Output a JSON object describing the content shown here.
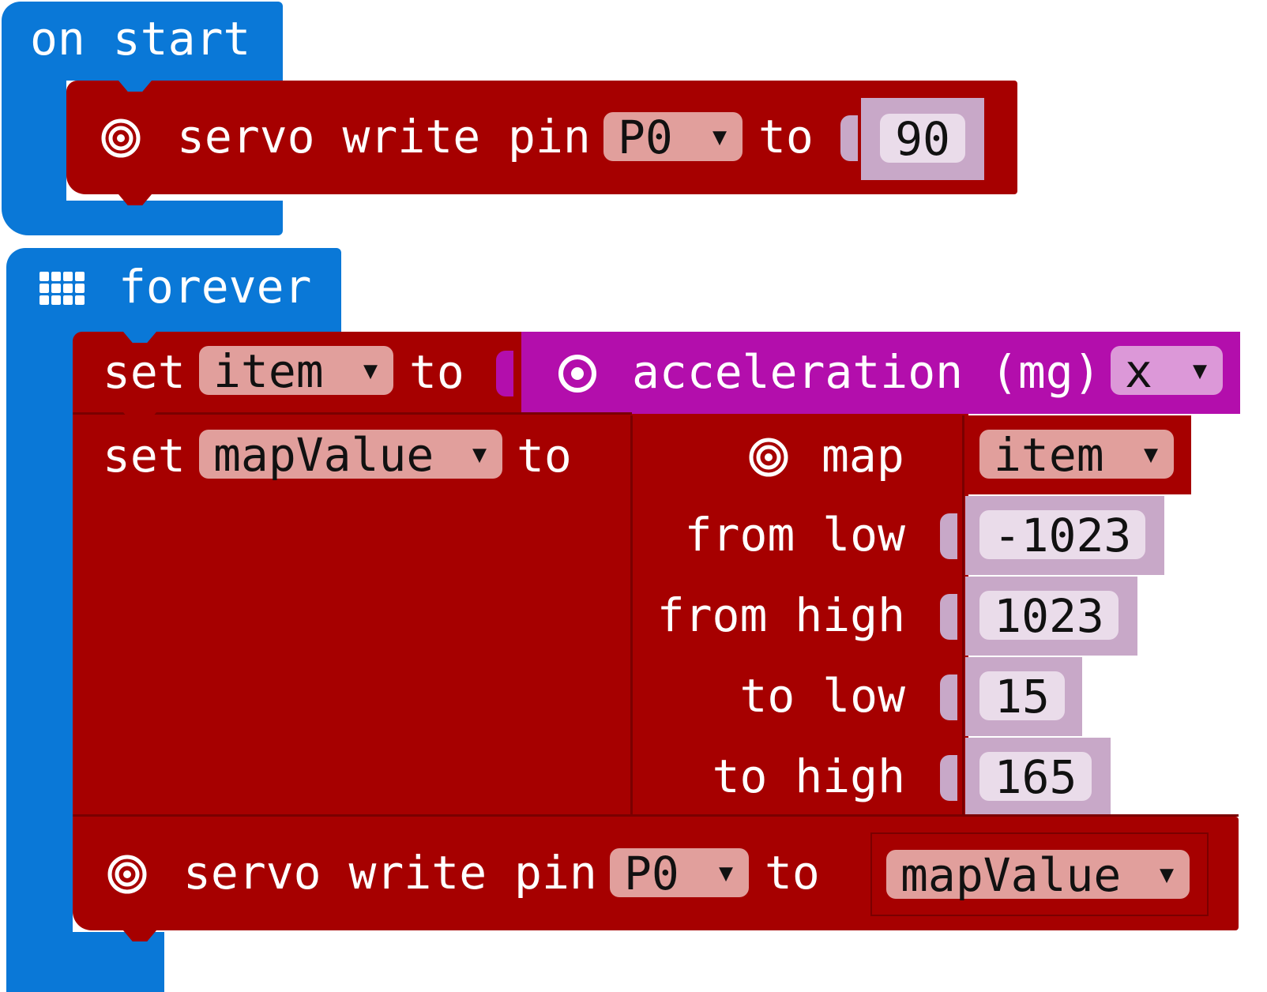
{
  "on_start": {
    "label": "on start",
    "servo_block": {
      "icon": "target-icon",
      "label": "servo write pin",
      "pin": "P0",
      "to_label": "to",
      "value": "90"
    }
  },
  "forever": {
    "icon": "grid-icon",
    "label": "forever",
    "set_item": {
      "set_label": "set",
      "variable": "item",
      "to_label": "to",
      "acceleration": {
        "icon": "radio-dot-icon",
        "label": "acceleration (mg)",
        "axis": "x"
      }
    },
    "set_map": {
      "set_label": "set",
      "variable": "mapValue",
      "to_label": "to",
      "map": {
        "icon": "target-icon",
        "label": "map",
        "input_var": "item",
        "from_low_label": "from low",
        "from_low": "-1023",
        "from_high_label": "from high",
        "from_high": "1023",
        "to_low_label": "to low",
        "to_low": "15",
        "to_high_label": "to high",
        "to_high": "165"
      }
    },
    "servo_block": {
      "icon": "target-icon",
      "label": "servo write pin",
      "pin": "P0",
      "to_label": "to",
      "value_var": "mapValue"
    }
  },
  "colors": {
    "event_blue": "#0a78d7",
    "pins_red": "#a60000",
    "input_purple": "#b30eac",
    "number_lavender": "#c8a8c8"
  }
}
